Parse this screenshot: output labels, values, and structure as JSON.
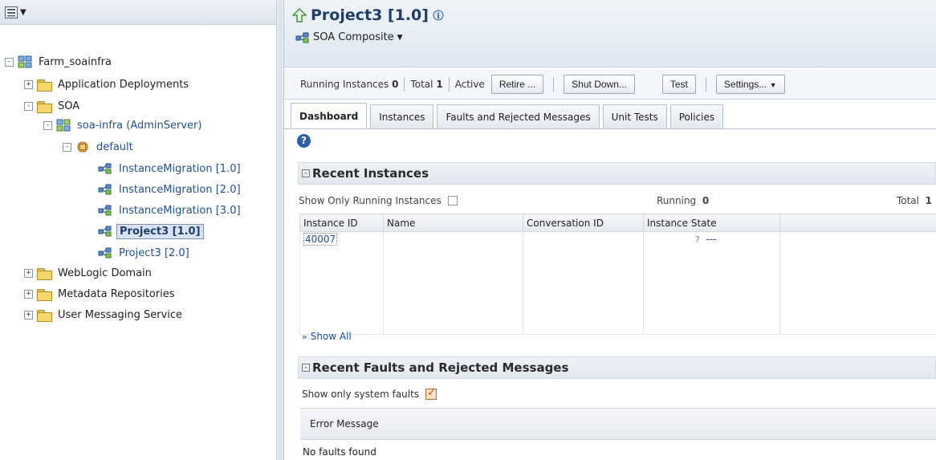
{
  "nav": {
    "tree": [
      {
        "label": "Farm_soainfra",
        "expander": "⊟",
        "icon": "farm-icon",
        "level": 0
      },
      {
        "label": "Application Deployments",
        "expander": "⊞",
        "icon": "folder-icon",
        "level": 1
      },
      {
        "label": "SOA",
        "expander": "⊟",
        "icon": "folder-icon",
        "level": 1
      },
      {
        "label": "soa-infra (AdminServer)",
        "expander": "⊟",
        "icon": "server-icon",
        "level": 2
      },
      {
        "label": "default",
        "expander": "⊟",
        "icon": "partition-icon",
        "level": 3
      },
      {
        "label": "InstanceMigration [1.0]",
        "icon": "composite-icon",
        "level": 4
      },
      {
        "label": "InstanceMigration [2.0]",
        "icon": "composite-icon",
        "level": 4
      },
      {
        "label": "InstanceMigration [3.0]",
        "icon": "composite-icon",
        "level": 4
      },
      {
        "label": "Project3 [1.0]",
        "icon": "composite-icon",
        "level": 4,
        "selected": true
      },
      {
        "label": "Project3 [2.0]",
        "icon": "composite-icon",
        "level": 4
      },
      {
        "label": "WebLogic Domain",
        "expander": "⊞",
        "icon": "folder-icon",
        "level": 1
      },
      {
        "label": "Metadata Repositories",
        "expander": "⊞",
        "icon": "folder-icon",
        "level": 1
      },
      {
        "label": "User Messaging Service",
        "expander": "⊞",
        "icon": "folder-icon",
        "level": 1
      }
    ]
  },
  "header": {
    "title": "Project3 [1.0]",
    "composite_menu": "SOA Composite"
  },
  "status": {
    "running_label": "Running Instances",
    "running_value": "0",
    "total_label": "Total",
    "total_value": "1",
    "active_label": "Active",
    "retire_btn": "Retire ...",
    "shutdown_btn": "Shut Down...",
    "test_btn": "Test",
    "settings_btn": "Settings..."
  },
  "tabs": [
    "Dashboard",
    "Instances",
    "Faults and Rejected Messages",
    "Unit Tests",
    "Policies"
  ],
  "recent_instances": {
    "title": "Recent Instances",
    "filter_label": "Show Only Running Instances",
    "running_label": "Running",
    "running_value": "0",
    "total_label": "Total",
    "total_value": "1",
    "columns": [
      "Instance ID",
      "Name",
      "Conversation ID",
      "Instance State"
    ],
    "rows": [
      {
        "id": "40007",
        "name": "",
        "conversation": "",
        "state": "---"
      }
    ],
    "show_all": "Show All"
  },
  "recent_faults": {
    "title": "Recent Faults and Rejected Messages",
    "system_faults_label": "Show only system faults",
    "error_column": "Error Message",
    "empty_text": "No faults found"
  },
  "colors": {
    "title": "#1f3d6b",
    "link": "#1f4f94",
    "up_arrow": "#3a9a3a"
  }
}
